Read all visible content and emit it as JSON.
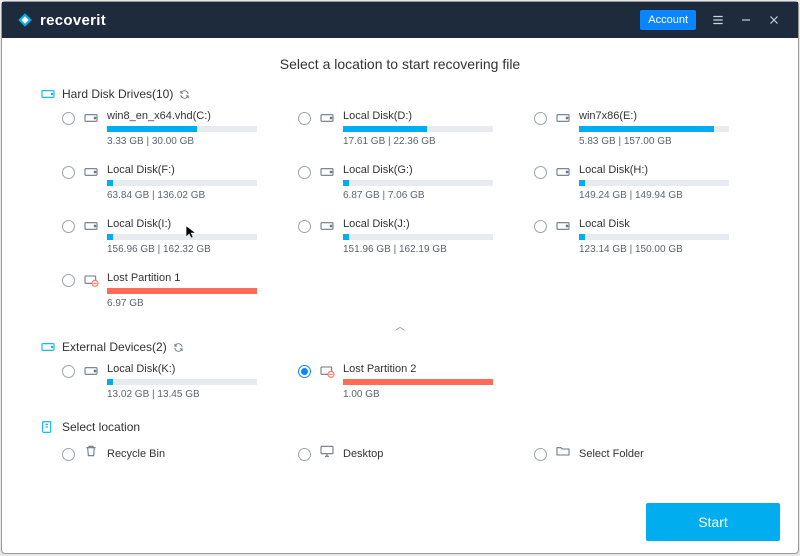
{
  "app_name": "recoverit",
  "header": {
    "account_label": "Account"
  },
  "page_title": "Select a location to start recovering file",
  "sections": {
    "hdd": {
      "label": "Hard Disk Drives(10)"
    },
    "ext": {
      "label": "External Devices(2)"
    },
    "sel": {
      "label": "Select location"
    }
  },
  "drives": [
    {
      "name": "win8_en_x64.vhd(C:)",
      "used": "3.33",
      "total": "30.00",
      "pct": 60,
      "lost": false
    },
    {
      "name": "Local Disk(D:)",
      "used": "17.61",
      "total": "22.36",
      "pct": 56,
      "lost": false
    },
    {
      "name": "win7x86(E:)",
      "used": "5.83",
      "total": "157.00",
      "pct": 90,
      "lost": false
    },
    {
      "name": "Local Disk(F:)",
      "used": "63.84",
      "total": "136.02",
      "pct": 4,
      "lost": false
    },
    {
      "name": "Local Disk(G:)",
      "used": "6.87",
      "total": "7.06",
      "pct": 4,
      "lost": false
    },
    {
      "name": "Local Disk(H:)",
      "used": "149.24",
      "total": "149.94",
      "pct": 4,
      "lost": false
    },
    {
      "name": "Local Disk(I:)",
      "used": "156.96",
      "total": "162.32",
      "pct": 4,
      "lost": false
    },
    {
      "name": "Local Disk(J:)",
      "used": "151.96",
      "total": "162.19",
      "pct": 4,
      "lost": false
    },
    {
      "name": "Local Disk",
      "used": "123.14",
      "total": "150.00",
      "pct": 4,
      "lost": false
    },
    {
      "name": "Lost Partition 1",
      "used": "6.97",
      "total": "",
      "pct": 100,
      "lost": true
    }
  ],
  "ext_drives": [
    {
      "name": "Local Disk(K:)",
      "used": "13.02",
      "total": "13.45",
      "pct": 4,
      "lost": false,
      "selected": false
    },
    {
      "name": "Lost Partition 2",
      "used": "1.00",
      "total": "",
      "pct": 100,
      "lost": true,
      "selected": true
    }
  ],
  "select_locations": [
    {
      "name": "Recycle Bin",
      "icon": "bin"
    },
    {
      "name": "Desktop",
      "icon": "desktop"
    },
    {
      "name": "Select Folder",
      "icon": "folder"
    }
  ],
  "start_label": "Start",
  "gb_label": "GB"
}
